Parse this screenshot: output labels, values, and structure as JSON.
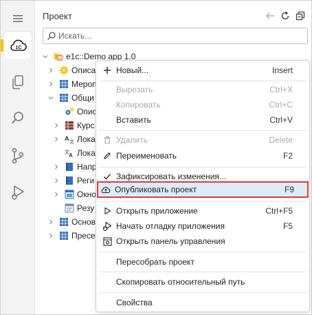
{
  "panel": {
    "title": "Проект"
  },
  "search": {
    "placeholder": "Искать..."
  },
  "tree": {
    "root": "e1c::Demo app 1.0",
    "items": [
      {
        "label": "Описа"
      },
      {
        "label": "Мероп"
      },
      {
        "label": "Общи"
      },
      {
        "label": "Опис"
      },
      {
        "label": "Курс"
      },
      {
        "label": "Лока"
      },
      {
        "label": "Лока"
      },
      {
        "label": "Напр"
      },
      {
        "label": "Реги"
      },
      {
        "label": "Окно"
      },
      {
        "label": "Резу"
      },
      {
        "label": "Основ"
      },
      {
        "label": "Пресе"
      }
    ]
  },
  "menu": {
    "new": {
      "label": "Новый...",
      "key": "Insert"
    },
    "cut": {
      "label": "Вырезать",
      "key": "Ctrl+X"
    },
    "copy": {
      "label": "Копировать",
      "key": "Ctrl+C"
    },
    "paste": {
      "label": "Вставить",
      "key": "Ctrl+V"
    },
    "delete": {
      "label": "Удалить",
      "key": "Delete"
    },
    "rename": {
      "label": "Переименовать",
      "key": "F2"
    },
    "commit": {
      "label": "Зафиксировать изменения..."
    },
    "publish": {
      "label": "Опубликовать проект",
      "key": "F9"
    },
    "open_app": {
      "label": "Открыть приложение",
      "key": "Ctrl+F5"
    },
    "debug": {
      "label": "Начать отладку приложения",
      "key": "F5"
    },
    "control_panel": {
      "label": "Открыть панель управления"
    },
    "rebuild": {
      "label": "Пересобрать проект"
    },
    "copy_path": {
      "label": "Скопировать относительный путь"
    },
    "properties": {
      "label": "Свойства"
    }
  },
  "colors": {
    "accent_yellow": "#f5c400",
    "highlight_bg": "#ddecf9",
    "highlight_border": "#e53935",
    "folder_blue": "#2f6fbf"
  }
}
